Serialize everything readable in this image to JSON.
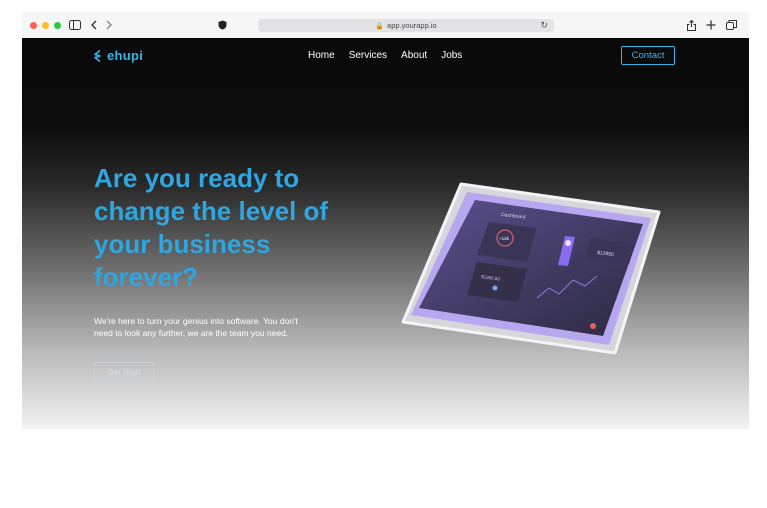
{
  "browser": {
    "url": "app.yourapp.io",
    "traffic_colors": [
      "#ff5f57",
      "#febc2e",
      "#28c840"
    ]
  },
  "brand": {
    "name": "ehupi",
    "accent": "#38b6e8"
  },
  "nav": {
    "items": [
      {
        "label": "Home"
      },
      {
        "label": "Services"
      },
      {
        "label": "About"
      },
      {
        "label": "Jobs"
      }
    ],
    "contact_label": "Contact"
  },
  "hero": {
    "headline": "Are you ready to change the level of your business forever?",
    "subtext": "We're here to turn your genius into software. You don't need to look any further, we are the team you need.",
    "cta_label": "Get Start",
    "headline_color": "#2fa6e0"
  },
  "device": {
    "dashboard_title": "Dashboard",
    "stat_a": "+12k",
    "stat_b": "$1365.00",
    "stat_c": "$12950"
  }
}
